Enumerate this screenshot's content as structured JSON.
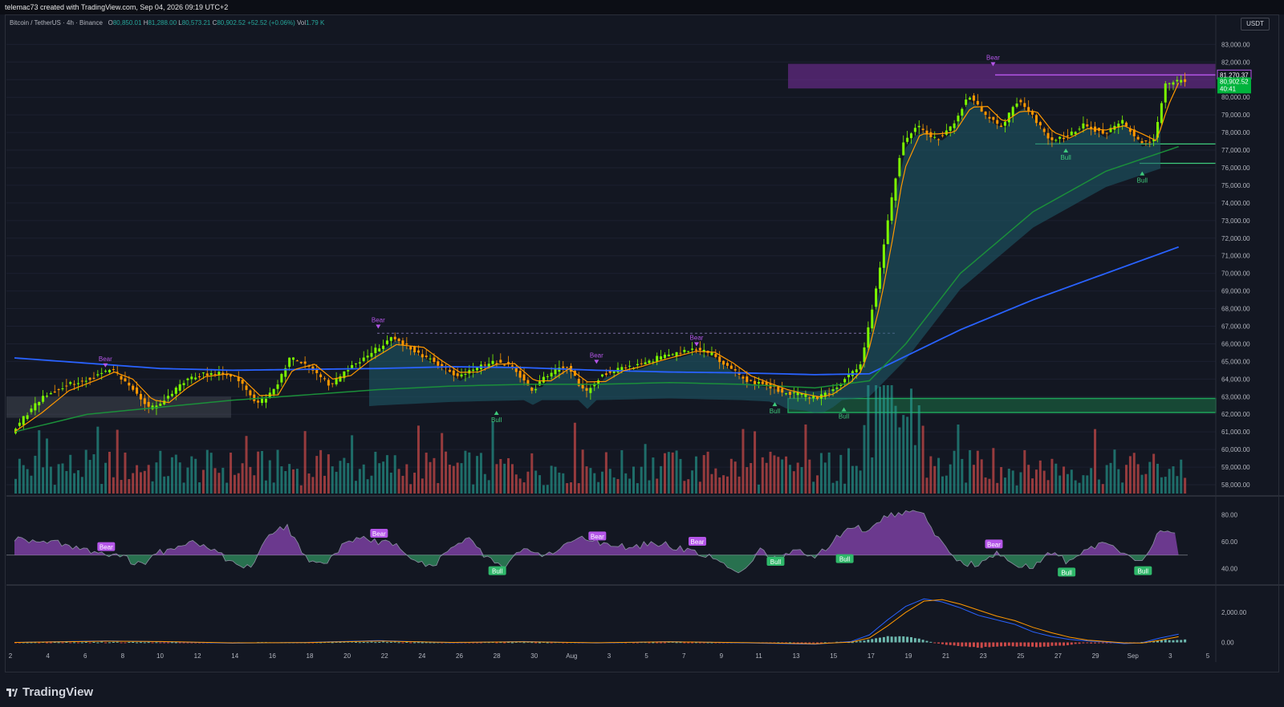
{
  "header": {
    "attribution": "telemac73 created with TradingView.com, Sep 04, 2026 09:19 UTC+2"
  },
  "legend": {
    "symbol": "Bitcoin / TetherUS · 4h · Binance",
    "open_label": "O",
    "open": "80,850.01",
    "high_label": "H",
    "high": "81,288.00",
    "low_label": "L",
    "low": "80,573.21",
    "close_label": "C",
    "close": "80,902.52",
    "change": "+52.52 (+0.06%)",
    "vol_label": "Vol",
    "vol": "1.79 K"
  },
  "currency_button": "USDT",
  "footer": {
    "logo_text": "TradingView"
  },
  "colors": {
    "background": "#131722",
    "bull": "#26a69a",
    "bear": "#ef5350",
    "candle_up": "#7cfc00",
    "candle_down": "#ff9800",
    "ma_blue": "#2962ff",
    "ma_green": "#1b8f3a",
    "ema_orange": "#ff9800",
    "cloud": "#1f5f6e",
    "zone_purple": "#7b2fa3",
    "zone_green": "#1fa35a",
    "osc_bull": "#3ecb7c",
    "osc_bear": "#b455e8"
  },
  "chart_data": [
    {
      "type": "candlestick",
      "title": "",
      "x_tick_labels": [
        "2",
        "4",
        "6",
        "8",
        "10",
        "12",
        "14",
        "16",
        "18",
        "20",
        "22",
        "24",
        "26",
        "28",
        "30",
        "Aug",
        "3",
        "5",
        "7",
        "9",
        "11",
        "13",
        "15",
        "17",
        "19",
        "21",
        "23",
        "25",
        "27",
        "29",
        "Sep",
        "3",
        "5"
      ],
      "ylim": [
        57500,
        83700
      ],
      "y_tick_labels": [
        "83,000.00",
        "82,000.00",
        "81,000.00",
        "80,000.00",
        "79,000.00",
        "78,000.00",
        "77,000.00",
        "76,000.00",
        "75,000.00",
        "74,000.00",
        "73,000.00",
        "72,000.00",
        "71,000.00",
        "70,000.00",
        "69,000.00",
        "68,000.00",
        "67,000.00",
        "66,000.00",
        "65,000.00",
        "64,000.00",
        "63,000.00",
        "62,000.00",
        "61,000.00",
        "60,000.00",
        "59,000.00",
        "58,000.00"
      ],
      "price_path": [
        [
          0,
          61000
        ],
        [
          1.5,
          62800
        ],
        [
          3,
          63700
        ],
        [
          4.5,
          64100
        ],
        [
          5.5,
          64600
        ],
        [
          6.5,
          63600
        ],
        [
          7.6,
          62300
        ],
        [
          8.5,
          62900
        ],
        [
          9.5,
          63900
        ],
        [
          10.5,
          64300
        ],
        [
          11.8,
          64300
        ],
        [
          12.5,
          63900
        ],
        [
          13.5,
          62500
        ],
        [
          14.5,
          63500
        ],
        [
          15.3,
          65200
        ],
        [
          16.5,
          64600
        ],
        [
          17.5,
          63600
        ],
        [
          18.5,
          64600
        ],
        [
          19.5,
          65300
        ],
        [
          21,
          66400
        ],
        [
          22.5,
          65400
        ],
        [
          23.5,
          64800
        ],
        [
          24.5,
          64100
        ],
        [
          25.5,
          64600
        ],
        [
          26.5,
          65000
        ],
        [
          27.5,
          64800
        ],
        [
          28.6,
          63300
        ],
        [
          29.5,
          64300
        ],
        [
          30.5,
          64800
        ],
        [
          31.5,
          63200
        ],
        [
          32.5,
          64300
        ],
        [
          33.5,
          64600
        ],
        [
          34.5,
          64800
        ],
        [
          35.5,
          65200
        ],
        [
          36.5,
          65400
        ],
        [
          37.5,
          65700
        ],
        [
          38.5,
          65400
        ],
        [
          39.5,
          64600
        ],
        [
          40.5,
          63900
        ],
        [
          41.5,
          63700
        ],
        [
          42.5,
          63200
        ],
        [
          43.5,
          63100
        ],
        [
          44.3,
          62900
        ],
        [
          45,
          63300
        ],
        [
          46,
          64200
        ],
        [
          46.6,
          64700
        ],
        [
          47,
          66500
        ],
        [
          47.6,
          69500
        ],
        [
          48.3,
          73800
        ],
        [
          48.9,
          77200
        ],
        [
          49.8,
          78400
        ],
        [
          50.8,
          77600
        ],
        [
          51.7,
          78300
        ],
        [
          52.6,
          80200
        ],
        [
          53.5,
          79000
        ],
        [
          54.4,
          78300
        ],
        [
          55.3,
          79800
        ],
        [
          56.2,
          78800
        ],
        [
          57.1,
          77500
        ],
        [
          58,
          77800
        ],
        [
          59,
          78500
        ],
        [
          60,
          77900
        ],
        [
          61,
          78700
        ],
        [
          62,
          77400
        ],
        [
          62.8,
          77600
        ],
        [
          63.4,
          80700
        ],
        [
          64,
          80900
        ]
      ],
      "ma_blue": [
        [
          0,
          65200
        ],
        [
          4,
          64900
        ],
        [
          8,
          64600
        ],
        [
          12,
          64500
        ],
        [
          16,
          64550
        ],
        [
          20,
          64600
        ],
        [
          24,
          64700
        ],
        [
          28,
          64650
        ],
        [
          32,
          64500
        ],
        [
          36,
          64400
        ],
        [
          40,
          64350
        ],
        [
          44,
          64250
        ],
        [
          47,
          64300
        ],
        [
          49,
          65300
        ],
        [
          52,
          66800
        ],
        [
          56,
          68500
        ],
        [
          60,
          70000
        ],
        [
          64,
          71500
        ]
      ],
      "ma_green": [
        [
          0,
          61000
        ],
        [
          4,
          62000
        ],
        [
          8,
          62400
        ],
        [
          12,
          62800
        ],
        [
          16,
          63100
        ],
        [
          20,
          63400
        ],
        [
          24,
          63600
        ],
        [
          28,
          63700
        ],
        [
          32,
          63700
        ],
        [
          36,
          63800
        ],
        [
          40,
          63700
        ],
        [
          44,
          63500
        ],
        [
          47,
          63900
        ],
        [
          49,
          66000
        ],
        [
          52,
          70000
        ],
        [
          56,
          73500
        ],
        [
          60,
          75800
        ],
        [
          64,
          77200
        ]
      ],
      "bear_zone": [
        80500,
        81900
      ],
      "bull_zone": [
        62100,
        62900
      ],
      "levels": [
        81270.37,
        77350,
        76250
      ],
      "markers": [
        {
          "label": "Bear",
          "x": 5,
          "y": 64800
        },
        {
          "label": "Bear",
          "x": 20,
          "y": 67000
        },
        {
          "label": "Bull",
          "x": 26.5,
          "y": 62100
        },
        {
          "label": "Bear",
          "x": 32,
          "y": 65000
        },
        {
          "label": "Bear",
          "x": 37.5,
          "y": 66000
        },
        {
          "label": "Bull",
          "x": 41.8,
          "y": 62600
        },
        {
          "label": "Bull",
          "x": 45.6,
          "y": 62300
        },
        {
          "label": "Bear",
          "x": 53.8,
          "y": 81900
        },
        {
          "label": "Bull",
          "x": 57.8,
          "y": 77000
        },
        {
          "label": "Bull",
          "x": 62,
          "y": 75700
        }
      ],
      "price_labels": {
        "level": "81,270.37",
        "last": "80,902.52",
        "countdown": "40:41"
      }
    },
    {
      "type": "bar",
      "title": "",
      "panel": "volume",
      "note_series": "volume histogram shares price pane"
    },
    {
      "type": "area",
      "panel": "oscillator",
      "title": "",
      "ylim": [
        30,
        90
      ],
      "y_tick_labels": [
        "80.00",
        "60.00",
        "40.00"
      ],
      "midline": 50,
      "path": [
        [
          0,
          62
        ],
        [
          2,
          60
        ],
        [
          4,
          54
        ],
        [
          6,
          48
        ],
        [
          7,
          42
        ],
        [
          8,
          52
        ],
        [
          10,
          60
        ],
        [
          12,
          45
        ],
        [
          13,
          40
        ],
        [
          14,
          66
        ],
        [
          15,
          71
        ],
        [
          16,
          48
        ],
        [
          17,
          42
        ],
        [
          18,
          56
        ],
        [
          19,
          64
        ],
        [
          20,
          60
        ],
        [
          21,
          58
        ],
        [
          22,
          45
        ],
        [
          23,
          40
        ],
        [
          24,
          56
        ],
        [
          25,
          63
        ],
        [
          26,
          47
        ],
        [
          27,
          40
        ],
        [
          28,
          56
        ],
        [
          29,
          50
        ],
        [
          30,
          54
        ],
        [
          31,
          63
        ],
        [
          32,
          60
        ],
        [
          33,
          58
        ],
        [
          34,
          55
        ],
        [
          35,
          60
        ],
        [
          36,
          57
        ],
        [
          37,
          54
        ],
        [
          38,
          50
        ],
        [
          39,
          43
        ],
        [
          40,
          38
        ],
        [
          41,
          54
        ],
        [
          42,
          46
        ],
        [
          43,
          54
        ],
        [
          44,
          48
        ],
        [
          45,
          60
        ],
        [
          46,
          72
        ],
        [
          47,
          68
        ],
        [
          48,
          80
        ],
        [
          49,
          82
        ],
        [
          50,
          80
        ],
        [
          51,
          58
        ],
        [
          52,
          45
        ],
        [
          53,
          42
        ],
        [
          54,
          52
        ],
        [
          55,
          44
        ],
        [
          56,
          40
        ],
        [
          57,
          52
        ],
        [
          58,
          44
        ],
        [
          59,
          55
        ],
        [
          60,
          58
        ],
        [
          61,
          50
        ],
        [
          62,
          44
        ],
        [
          63,
          70
        ],
        [
          64,
          68
        ]
      ],
      "markers": [
        {
          "label": "Bear",
          "x": 5,
          "y": 56
        },
        {
          "label": "Bear",
          "x": 20,
          "y": 66
        },
        {
          "label": "Bull",
          "x": 26.5,
          "y": 38
        },
        {
          "label": "Bear",
          "x": 32,
          "y": 64
        },
        {
          "label": "Bear",
          "x": 37.5,
          "y": 60
        },
        {
          "label": "Bull",
          "x": 41.8,
          "y": 45
        },
        {
          "label": "Bull",
          "x": 45.6,
          "y": 47
        },
        {
          "label": "Bear",
          "x": 53.8,
          "y": 58
        },
        {
          "label": "Bull",
          "x": 57.8,
          "y": 37
        },
        {
          "label": "Bull",
          "x": 62,
          "y": 38
        }
      ]
    },
    {
      "type": "line",
      "panel": "macd",
      "title": "",
      "ylim": [
        -400,
        3500
      ],
      "y_tick_labels": [
        "2,000.00",
        "0.00"
      ],
      "macd": [
        [
          0,
          0
        ],
        [
          5,
          100
        ],
        [
          8,
          50
        ],
        [
          12,
          -50
        ],
        [
          16,
          0
        ],
        [
          20,
          120
        ],
        [
          24,
          -20
        ],
        [
          28,
          60
        ],
        [
          32,
          -40
        ],
        [
          36,
          50
        ],
        [
          40,
          -30
        ],
        [
          44,
          -120
        ],
        [
          46,
          60
        ],
        [
          47,
          500
        ],
        [
          48,
          1500
        ],
        [
          49,
          2400
        ],
        [
          50,
          2900
        ],
        [
          51,
          2700
        ],
        [
          52,
          2300
        ],
        [
          53,
          1800
        ],
        [
          54,
          1500
        ],
        [
          55,
          1200
        ],
        [
          56,
          700
        ],
        [
          57,
          400
        ],
        [
          58,
          200
        ],
        [
          59,
          100
        ],
        [
          60,
          30
        ],
        [
          61,
          -80
        ],
        [
          62,
          -20
        ],
        [
          63,
          300
        ],
        [
          64,
          550
        ]
      ],
      "signal": [
        [
          0,
          0
        ],
        [
          5,
          80
        ],
        [
          8,
          60
        ],
        [
          12,
          -30
        ],
        [
          16,
          -10
        ],
        [
          20,
          90
        ],
        [
          24,
          0
        ],
        [
          28,
          40
        ],
        [
          32,
          -20
        ],
        [
          36,
          40
        ],
        [
          40,
          -10
        ],
        [
          44,
          -90
        ],
        [
          46,
          20
        ],
        [
          47,
          300
        ],
        [
          48,
          1100
        ],
        [
          49,
          2000
        ],
        [
          50,
          2750
        ],
        [
          51,
          2850
        ],
        [
          52,
          2550
        ],
        [
          53,
          2150
        ],
        [
          54,
          1750
        ],
        [
          55,
          1450
        ],
        [
          56,
          1000
        ],
        [
          57,
          650
        ],
        [
          58,
          350
        ],
        [
          59,
          150
        ],
        [
          60,
          60
        ],
        [
          61,
          -30
        ],
        [
          62,
          -40
        ],
        [
          63,
          150
        ],
        [
          64,
          380
        ]
      ]
    }
  ]
}
